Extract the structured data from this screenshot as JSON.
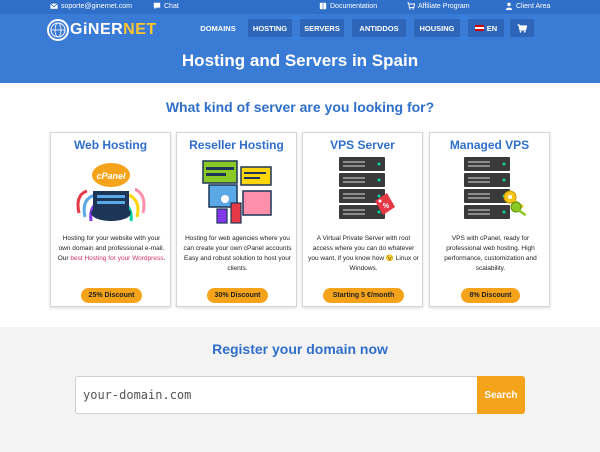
{
  "topbar": {
    "email": "soporte@ginernet.com",
    "chat": "Chat",
    "documentation": "Documentation",
    "affiliate": "Affiliate Program",
    "client_area": "Client Area"
  },
  "logo": {
    "part1": "GiNER",
    "part2": "NET"
  },
  "nav": {
    "domains": "DOMAINS",
    "hosting": "HOSTING",
    "servers": "SERVERS",
    "antiddos": "ANTIDDOS",
    "housing": "HOUSING",
    "language": "EN"
  },
  "hero": {
    "title": "Hosting and Servers in Spain"
  },
  "servers_section": {
    "title": "What kind of server are you looking for?"
  },
  "cards": [
    {
      "title": "Web Hosting",
      "desc": "Hosting for your website with your own domain and professional e-mail. Our ",
      "link": "best Hosting for your Wordpress",
      "desc_end": ".",
      "badge": "25% Discount"
    },
    {
      "title": "Reseller Hosting",
      "desc": "Hosting for web agencies where you can create your own cPanel accounts Easy and robust solution to host your clients.",
      "badge": "30% Discount"
    },
    {
      "title": "VPS Server",
      "desc": "A Virtual Private Server with root access where you can do whatever you want, if you know how 😉 Linux or Windows.",
      "badge": "Starting 5 €/month"
    },
    {
      "title": "Managed VPS",
      "desc": "VPS with cPanel, ready for professional web hosting. High performance, customization and scalability.",
      "badge": "8% Discount"
    }
  ],
  "icons": {
    "cpanel_label": "cPanel"
  },
  "domain": {
    "title": "Register your domain now",
    "placeholder": "your-domain.com",
    "button": "Search"
  },
  "colors": {
    "primary_blue": "#3a7bd5",
    "heading_blue": "#2f6fca",
    "accent_orange": "#f5a31a",
    "link_pink": "#d6336c",
    "logo_yellow": "#ffc72c"
  }
}
